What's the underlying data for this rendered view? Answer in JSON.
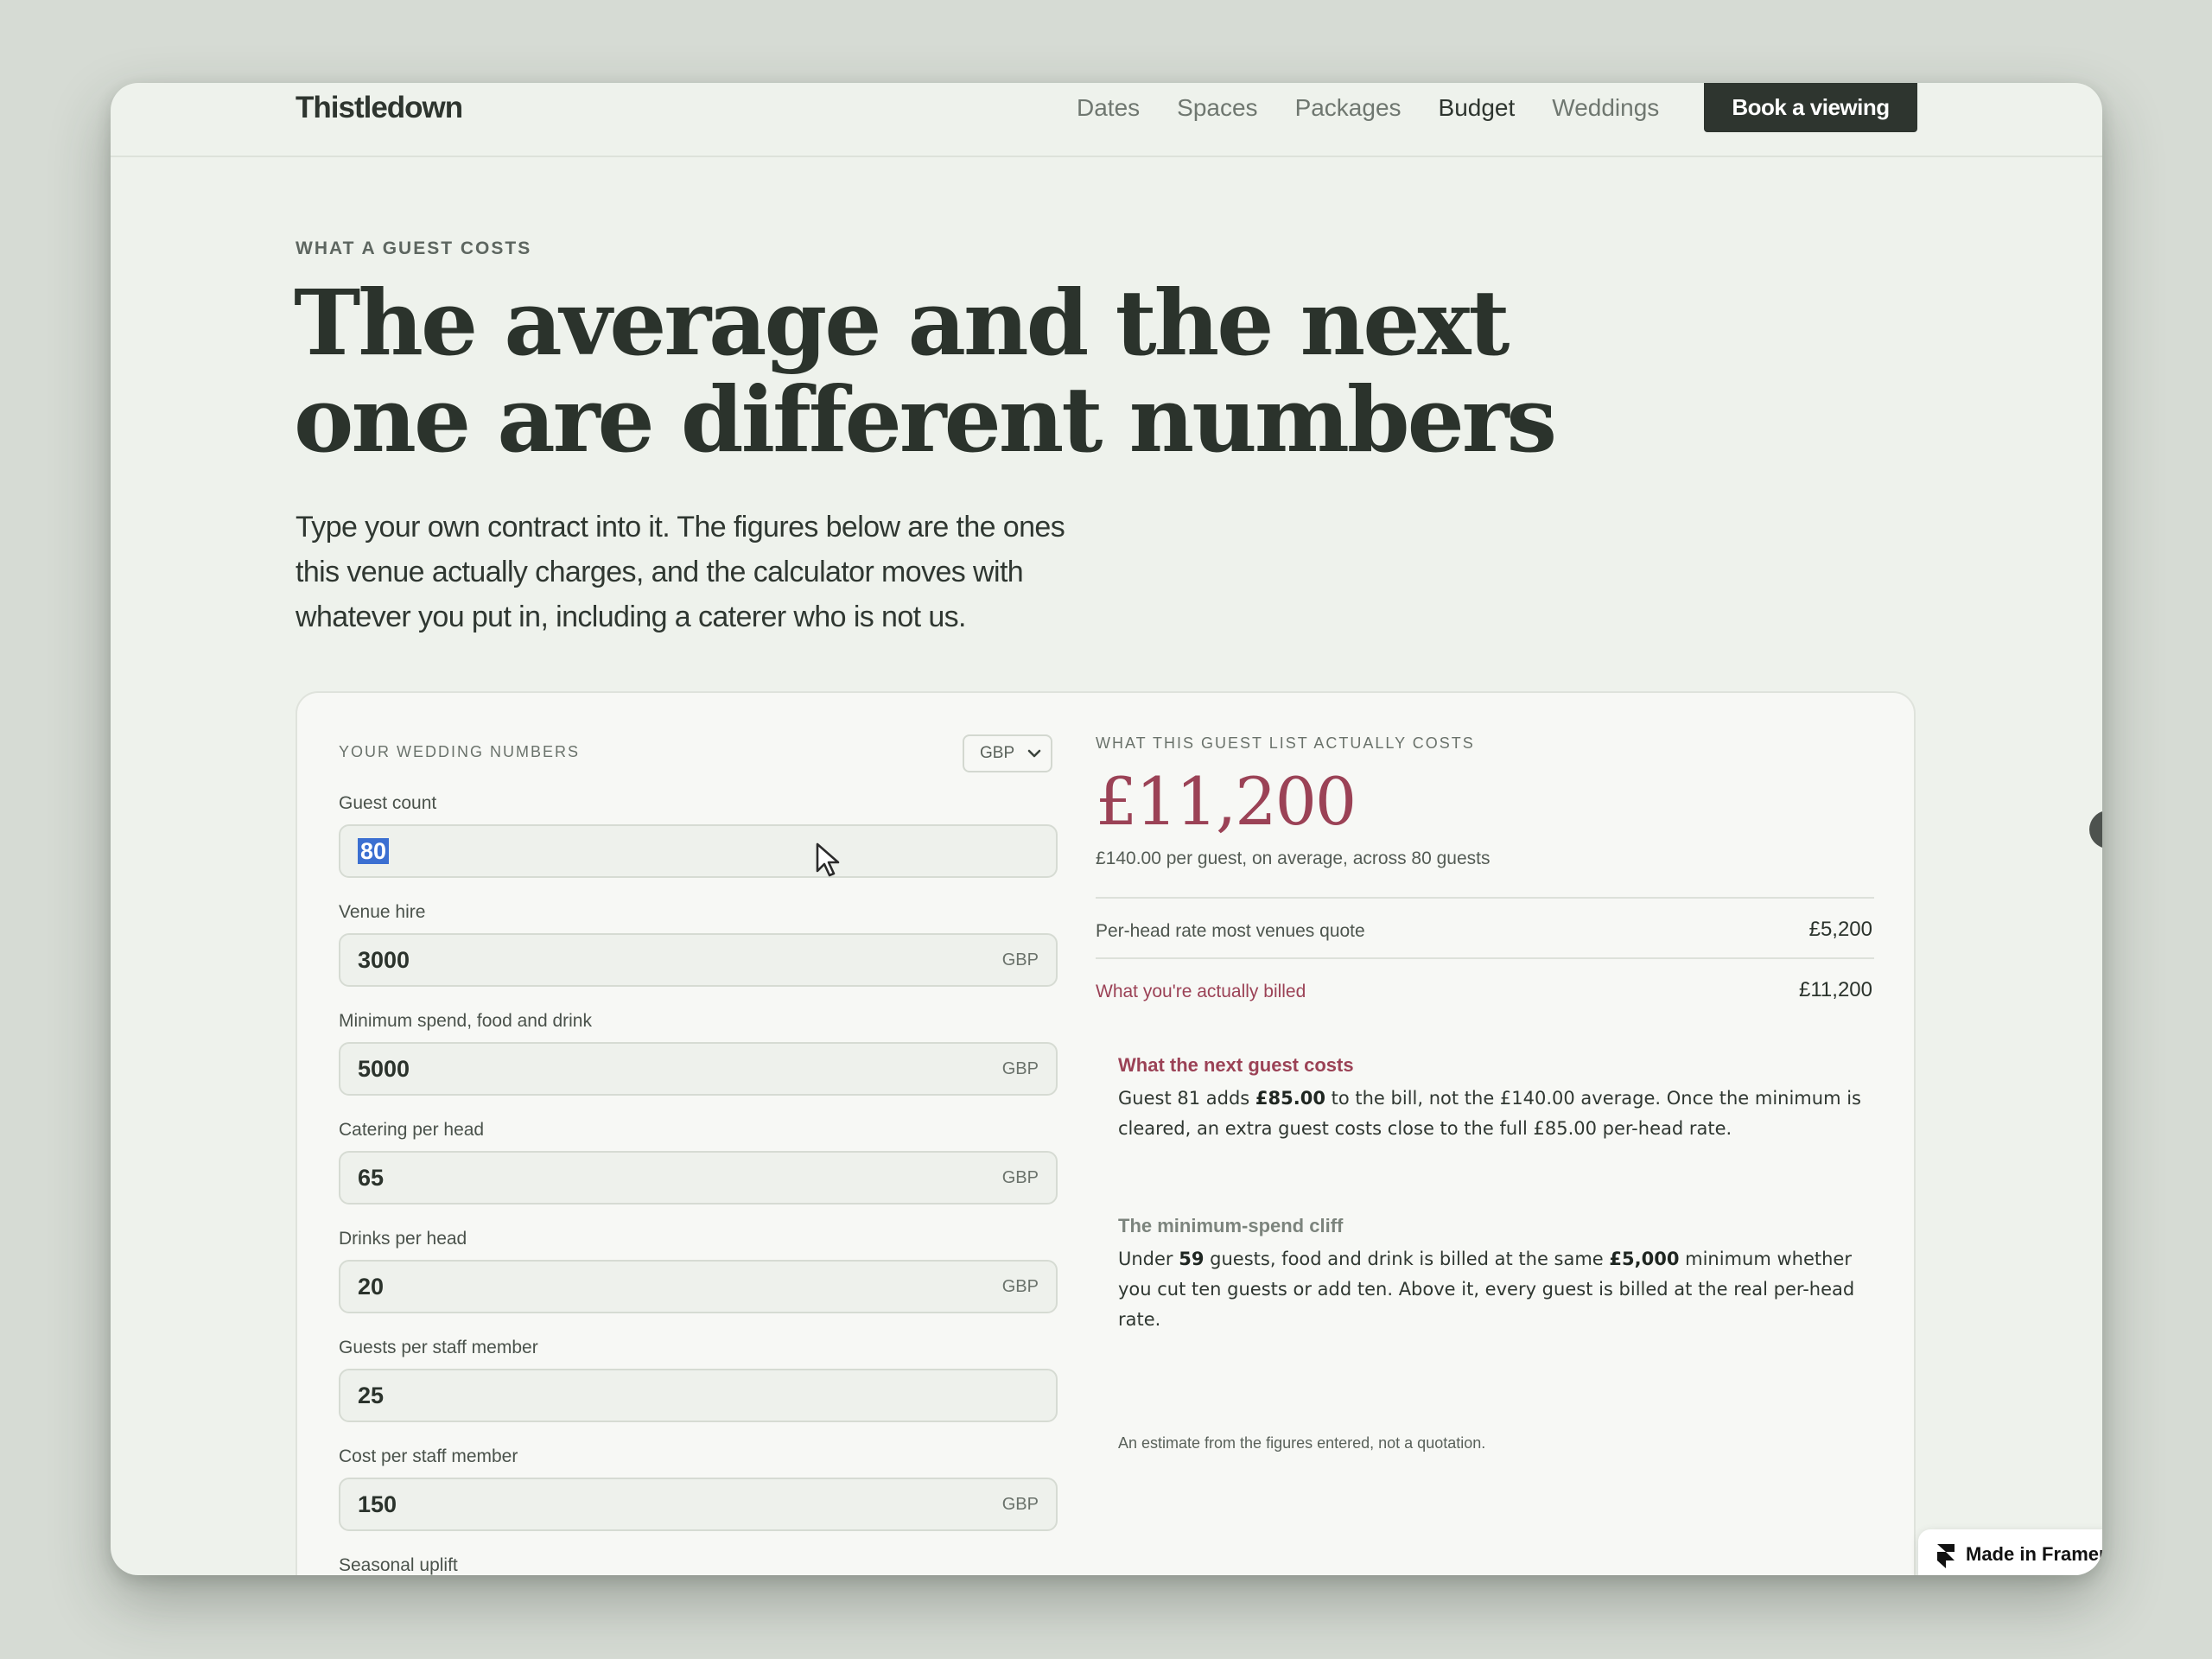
{
  "nav": {
    "brand": "Thistledown",
    "links": [
      "Dates",
      "Spaces",
      "Packages",
      "Budget",
      "Weddings"
    ],
    "cta": "Book a viewing"
  },
  "hero": {
    "eyebrow": "WHAT A GUEST COSTS",
    "title_line1": "The average and the next",
    "title_line2": "one are different numbers",
    "lead": "Type your own contract into it. The figures below are the ones this venue actually charges, and the calculator moves with whatever you put in, including a caterer who is not us."
  },
  "form": {
    "label": "YOUR WEDDING NUMBERS",
    "currency": "GBP",
    "unit": "GBP",
    "fields": [
      {
        "label": "Guest count",
        "value": "80"
      },
      {
        "label": "Venue hire",
        "value": "3000"
      },
      {
        "label": "Minimum spend, food and drink",
        "value": "5000"
      },
      {
        "label": "Catering per head",
        "value": "65"
      },
      {
        "label": "Drinks per head",
        "value": "20"
      },
      {
        "label": "Guests per staff member",
        "value": "25"
      },
      {
        "label": "Cost per staff member",
        "value": "150"
      },
      {
        "label": "Seasonal uplift",
        "value": ""
      }
    ]
  },
  "result": {
    "label": "WHAT THIS GUEST LIST ACTUALLY COSTS",
    "total": "£11,200",
    "per_guest": "£140.00 per guest, on average, across 80 guests",
    "rows": [
      {
        "label": "Per-head rate most venues quote",
        "value": "£5,200"
      },
      {
        "label": "What you're actually billed",
        "value": "£11,200"
      }
    ],
    "next_title": "What the next guest costs",
    "next_pre": "Guest 81 adds ",
    "next_amount": "£85.00",
    "next_post": " to the bill, not the £140.00 average. Once the minimum is cleared, an extra guest costs close to the full £85.00 per-head rate.",
    "cliff_title": "The minimum-spend cliff",
    "cliff_pre": "Under ",
    "cliff_guests": "59",
    "cliff_mid": " guests, food and drink is billed at the same ",
    "cliff_amount": "£5,000",
    "cliff_post": " minimum whether you cut ten guests or add ten. Above it, every guest is billed at the real per-head rate.",
    "disclaimer": "An estimate from the figures entered, not a quotation."
  },
  "badge": {
    "text": "Made in Framer"
  }
}
